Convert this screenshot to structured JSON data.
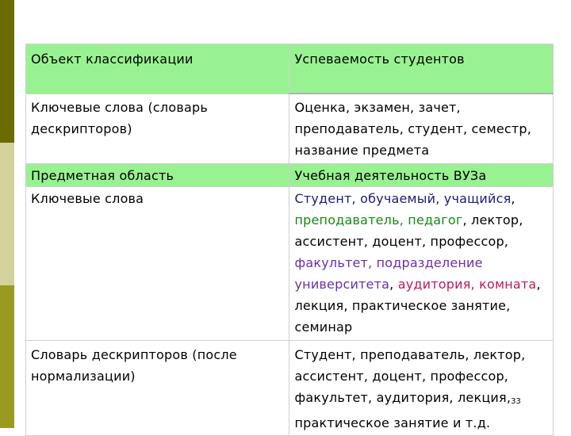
{
  "rows": [
    {
      "label": "Объект классификации",
      "value": "Успеваемость студентов"
    },
    {
      "label": "Ключевые слова (словарь дескрипторов)",
      "value": "Оценка, экзамен, зачет, преподаватель, студент, семестр, название предмета"
    },
    {
      "label": "Предметная область",
      "value": "Учебная деятельность ВУЗа"
    },
    {
      "label": "Ключевые слова",
      "segments": [
        {
          "text": "Студент, обучаемый, учащийся",
          "color": "#1b1b7a"
        },
        {
          "text": ", ",
          "color": "#000000"
        },
        {
          "text": "преподаватель, педагог",
          "color": "#138a13"
        },
        {
          "text": ", лектор, ассистент, доцент, профессор, ",
          "color": "#000000"
        },
        {
          "text": "факультет, подразделение университета",
          "color": "#6b2fa8"
        },
        {
          "text": ", ",
          "color": "#000000"
        },
        {
          "text": "аудитория, комната",
          "color": "#c2185b"
        },
        {
          "text": ", лекция, практическое занятие, семинар",
          "color": "#000000"
        }
      ]
    },
    {
      "label": "Словарь дескрипторов (после нормализации)",
      "value_part1": "Студент, преподаватель, лектор, ассистент, доцент, профессор, факультет, аудитория, лекция,",
      "value_part2": "практическое занятие и т.д."
    }
  ],
  "page_number": "33",
  "colors": {
    "header_row_bg": "#99f291",
    "side_bar_dark": "#6b6b00",
    "side_bar_light": "#d2d29a",
    "side_bar_mid": "#9a9a22"
  }
}
